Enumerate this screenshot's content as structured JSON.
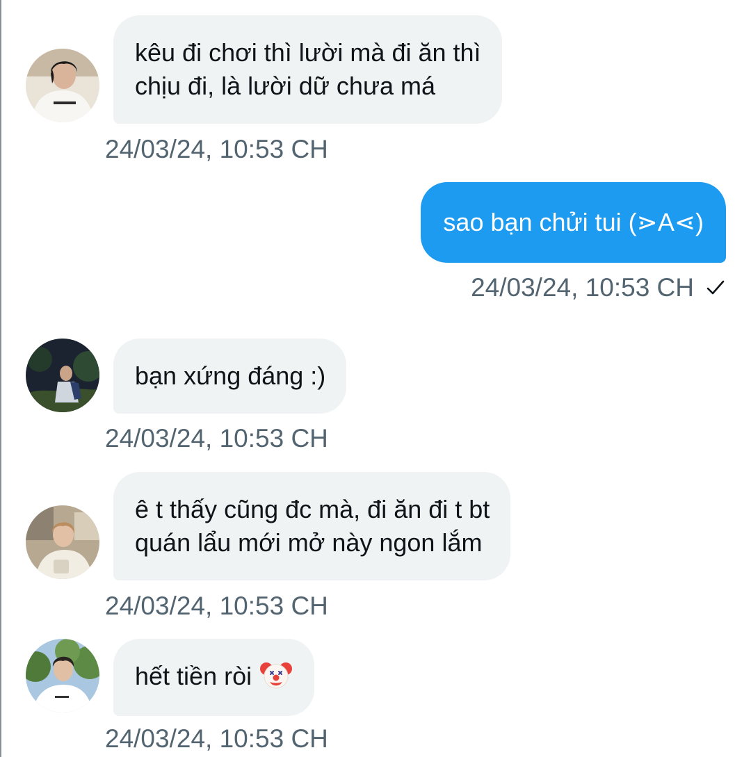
{
  "conversation": {
    "messages": [
      {
        "direction": "incoming",
        "avatar": "avatar-white-shirt-icon",
        "lines": [
          "kêu đi chơi thì lười mà đi ăn thì",
          "chịu đi, là lười dữ chưa má"
        ],
        "timestamp": "24/03/24, 10:53 CH"
      },
      {
        "direction": "outgoing",
        "lines": [
          "sao bạn chửi tui (⋗A⋖)"
        ],
        "timestamp": "24/03/24, 10:53 CH",
        "status_icon": "check-icon"
      },
      {
        "direction": "incoming",
        "avatar": "avatar-outdoor-night-icon",
        "lines": [
          "bạn xứng đáng :)"
        ],
        "timestamp": "24/03/24, 10:53 CH"
      },
      {
        "direction": "incoming",
        "avatar": "avatar-cafe-icon",
        "lines": [
          "ê t thấy cũng đc mà, đi ăn đi t bt",
          "quán lẩu mới mở này ngon lắm"
        ],
        "timestamp": "24/03/24, 10:53 CH"
      },
      {
        "direction": "incoming",
        "avatar": "avatar-trees-icon",
        "lines": [
          "hết tiền ròi"
        ],
        "emoji": "clown-face-icon",
        "timestamp": "24/03/24, 10:53 CH"
      }
    ]
  },
  "colors": {
    "incoming_bubble": "#eff3f4",
    "outgoing_bubble": "#1d9bf0",
    "timestamp_text": "#536471",
    "message_text": "#0f1419"
  }
}
